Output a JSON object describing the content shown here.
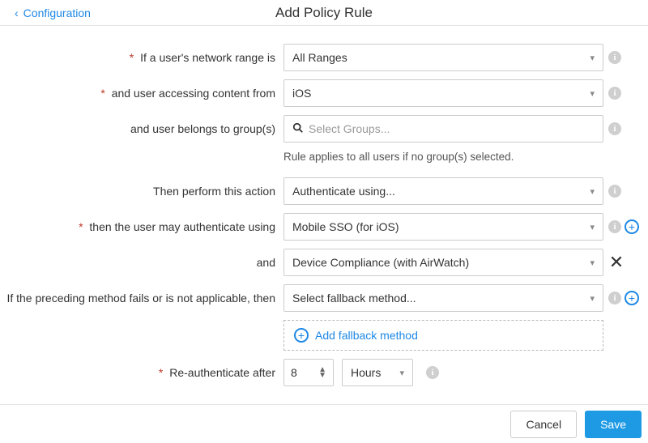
{
  "header": {
    "back_label": "Configuration",
    "title": "Add Policy Rule"
  },
  "labels": {
    "network_range": "If a user's network range is",
    "accessing_from": "and user accessing content from",
    "belongs_to": "and user belongs to group(s)",
    "group_hint": "Rule applies to all users if no group(s) selected.",
    "perform_action": "Then perform this action",
    "may_auth": "then the user may authenticate using",
    "and": "and",
    "fallback": "If the preceding method fails or is not applicable, then",
    "add_fallback": "Add fallback method",
    "reauth": "Re-authenticate after"
  },
  "values": {
    "network_range": "All Ranges",
    "accessing_from": "iOS",
    "groups_placeholder": "Select Groups...",
    "perform_action": "Authenticate using...",
    "auth_method_1": "Mobile SSO (for iOS)",
    "auth_method_2": "Device Compliance (with AirWatch)",
    "fallback_placeholder": "Select fallback method...",
    "reauth_value": "8",
    "reauth_unit": "Hours"
  },
  "footer": {
    "cancel": "Cancel",
    "save": "Save"
  }
}
